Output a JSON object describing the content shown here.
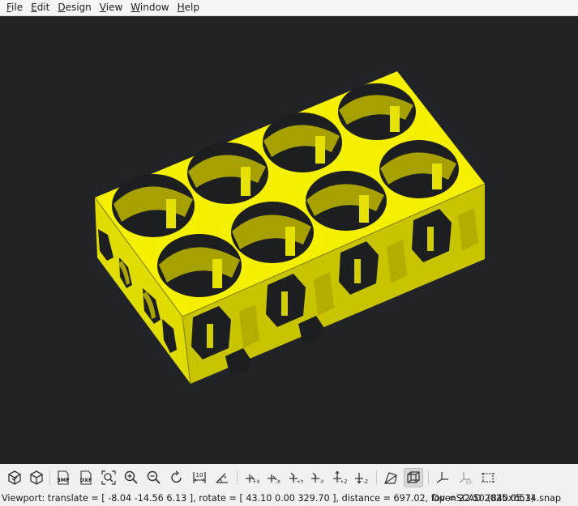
{
  "menu": {
    "items": [
      "File",
      "Edit",
      "Design",
      "View",
      "Window",
      "Help"
    ]
  },
  "viewport": {
    "background": "#212326",
    "model_color": "#f5f000",
    "model_shade": "#c7c200",
    "model_dark": "#9f9900"
  },
  "toolbar": {
    "buttons": [
      {
        "name": "render-preview-button",
        "icon": "preview-cube-icon"
      },
      {
        "name": "render-button",
        "icon": "render-cube-icon"
      },
      {
        "name": "export-3mf-button",
        "icon": "3mf-file-icon",
        "label": "3MF"
      },
      {
        "name": "export-dxf-button",
        "icon": "dxf-file-icon",
        "label": "DXF"
      },
      {
        "name": "view-all-button",
        "icon": "zoom-fit-icon"
      },
      {
        "name": "zoom-in-button",
        "icon": "zoom-in-icon"
      },
      {
        "name": "zoom-out-button",
        "icon": "zoom-out-icon"
      },
      {
        "name": "reset-view-button",
        "icon": "reset-rotate-icon"
      },
      {
        "name": "measure-distance-button",
        "icon": "measure-icon"
      },
      {
        "name": "measure-angle-button",
        "icon": "angle-measure-icon"
      },
      {
        "name": "view-right-button",
        "icon": "view-plus-x-icon",
        "label": "+X"
      },
      {
        "name": "view-left-button",
        "icon": "view-minus-x-icon",
        "label": "-X"
      },
      {
        "name": "view-back-button",
        "icon": "view-plus-y-icon",
        "label": "+Y"
      },
      {
        "name": "view-front-button",
        "icon": "view-minus-y-icon",
        "label": "-Y"
      },
      {
        "name": "view-top-button",
        "icon": "view-plus-z-icon",
        "label": "+Z"
      },
      {
        "name": "view-bottom-button",
        "icon": "view-minus-z-icon",
        "label": "-Z"
      },
      {
        "name": "perspective-button",
        "icon": "perspective-icon"
      },
      {
        "name": "orthogonal-button",
        "icon": "orthogonal-icon"
      },
      {
        "name": "show-axes-button",
        "icon": "axes-icon"
      },
      {
        "name": "show-scale-markers-button",
        "icon": "scale-markers-icon",
        "label": "10"
      },
      {
        "name": "show-edges-button",
        "icon": "edges-icon"
      }
    ]
  },
  "status": {
    "viewport_info": "Viewport: translate = [ -8.04 -14.56 6.13 ], rotate = [ 43.10 0.00 329.70 ], distance = 697.02, fov = 22.50 (840x653)",
    "version": "OpenSCAD 2025.05.14.snap"
  }
}
